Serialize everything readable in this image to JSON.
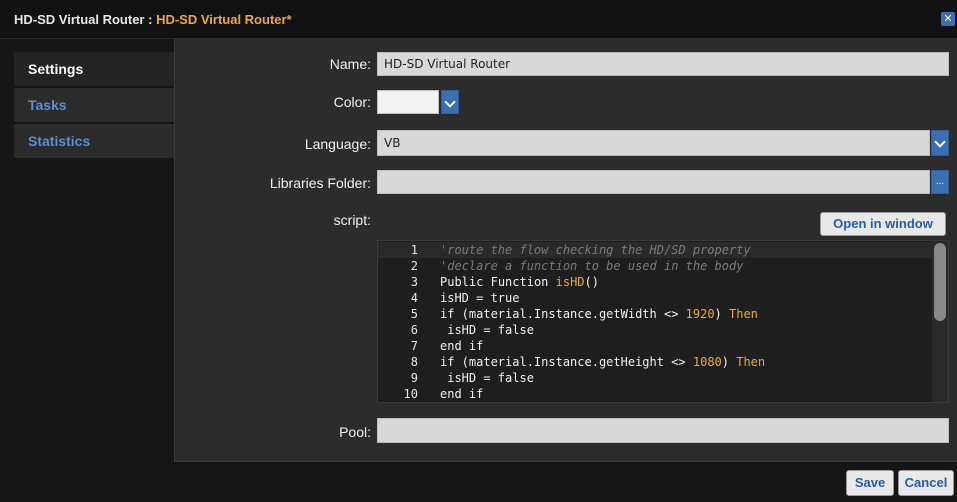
{
  "window": {
    "title_prefix": "HD-SD Virtual Router : ",
    "title_accent": "HD-SD Virtual Router*",
    "close_symbol": "✕"
  },
  "sidebar": {
    "items": [
      {
        "label": "Settings",
        "state": "active"
      },
      {
        "label": "Tasks",
        "state": "inactive"
      },
      {
        "label": "Statistics",
        "state": "inactive"
      }
    ]
  },
  "form": {
    "name_label": "Name:",
    "name_value": "HD-SD Virtual Router",
    "color_label": "Color:",
    "color_value": "",
    "language_label": "Language:",
    "language_value": "VB",
    "libraries_label": "Libraries Folder:",
    "libraries_value": "",
    "libraries_button": "...",
    "script_label": "script:",
    "open_window_label": "Open in window",
    "pool_label": "Pool:",
    "pool_value": ""
  },
  "editor": {
    "lines": [
      {
        "num": "1",
        "text": "'route the flow checking the HD/SD property"
      },
      {
        "num": "2",
        "text": "'declare a function to be used in the body"
      },
      {
        "num": "3",
        "text": "Public Function isHD()"
      },
      {
        "num": "4",
        "text": "isHD = true"
      },
      {
        "num": "5",
        "text": "if (material.Instance.getWidth <> 1920) Then"
      },
      {
        "num": "6",
        "text": " isHD = false"
      },
      {
        "num": "7",
        "text": "end if"
      },
      {
        "num": "8",
        "text": "if (material.Instance.getHeight <> 1080) Then"
      },
      {
        "num": "9",
        "text": " isHD = false"
      },
      {
        "num": "10",
        "text": "end if"
      }
    ]
  },
  "footer": {
    "save_label": "Save",
    "cancel_label": "Cancel"
  },
  "colors": {
    "accent_orange": "#f0a73a",
    "accent_blue": "#3a6fb2",
    "link_blue": "#5a8fd6"
  }
}
